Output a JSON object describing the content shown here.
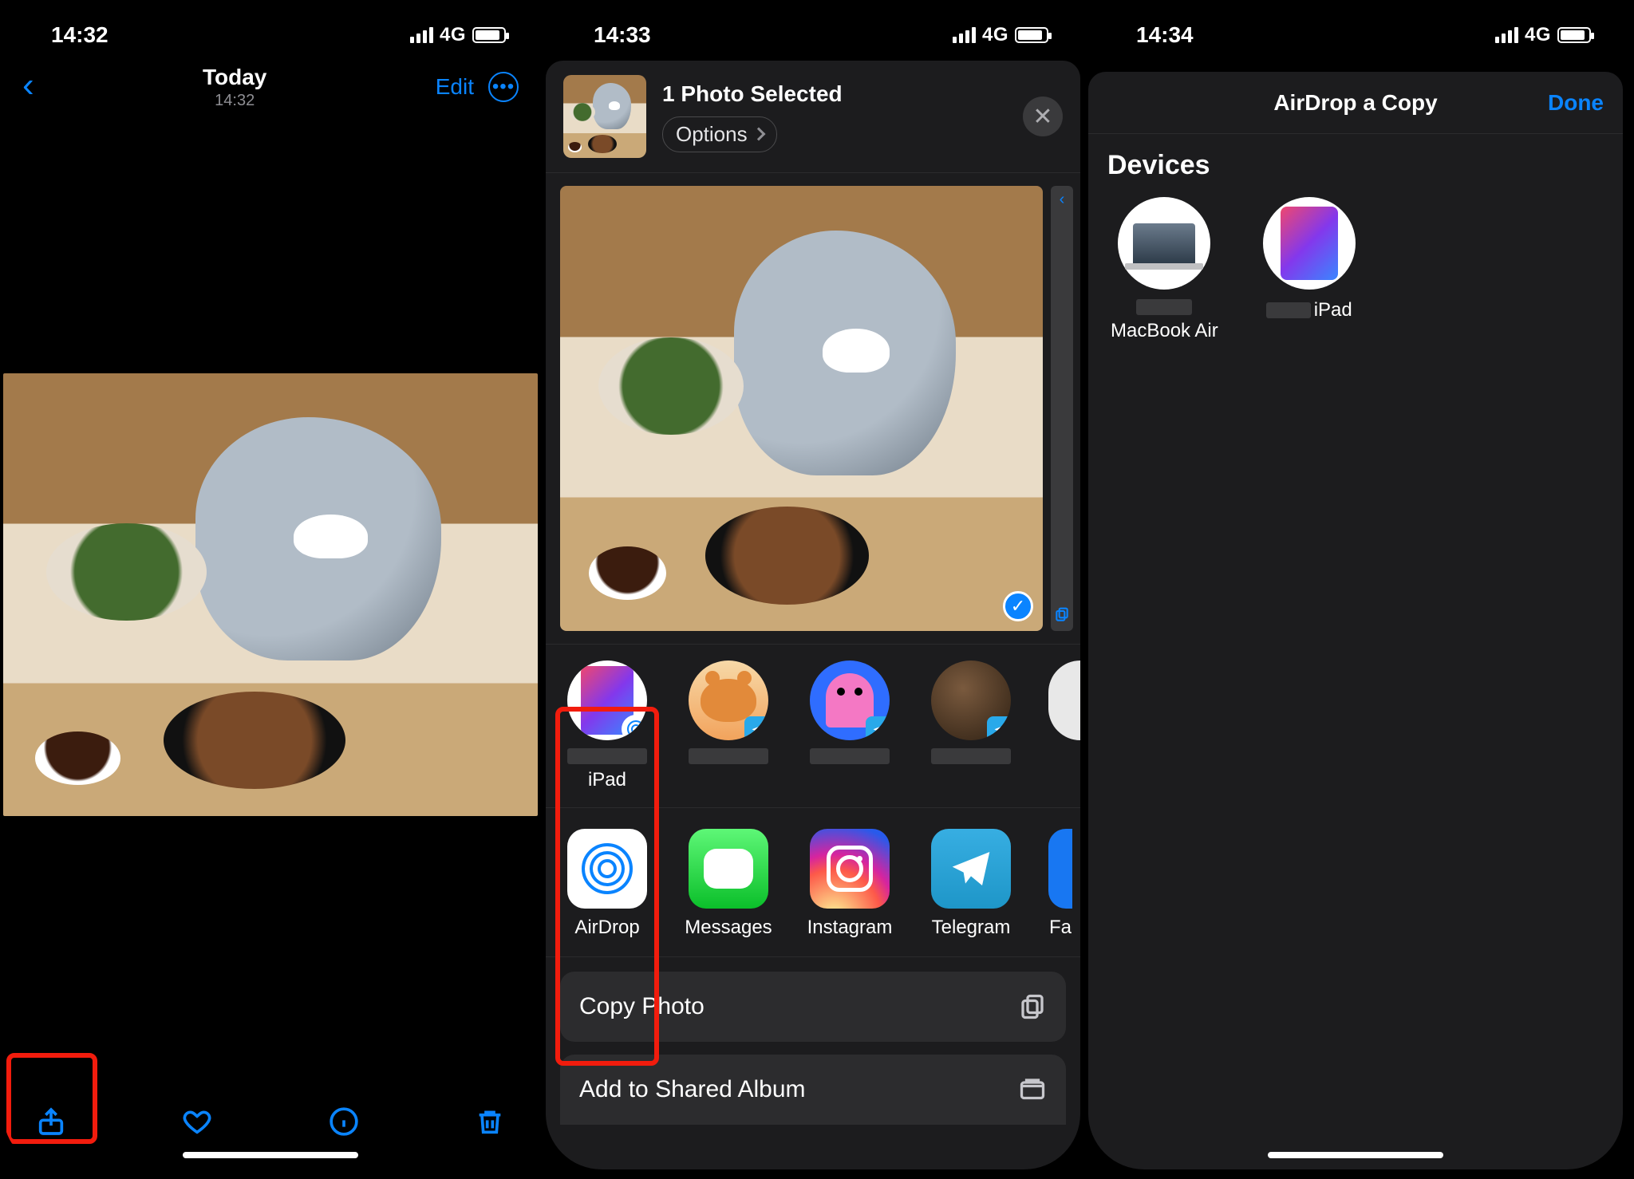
{
  "screen1": {
    "status": {
      "time": "14:32",
      "network": "4G"
    },
    "nav": {
      "title": "Today",
      "subtitle": "14:32",
      "edit": "Edit"
    }
  },
  "screen2": {
    "status": {
      "time": "14:33",
      "network": "4G"
    },
    "selected_title": "1 Photo Selected",
    "options": "Options",
    "contacts": [
      {
        "label": "iPad"
      },
      {
        "label": ""
      },
      {
        "label": ""
      },
      {
        "label": ""
      }
    ],
    "apps": {
      "airdrop": "AirDrop",
      "messages": "Messages",
      "instagram": "Instagram",
      "telegram": "Telegram",
      "facebook": "Fa"
    },
    "actions": {
      "copy": "Copy Photo",
      "shared_album": "Add to Shared Album"
    }
  },
  "screen3": {
    "status": {
      "time": "14:34",
      "network": "4G"
    },
    "title": "AirDrop a Copy",
    "done": "Done",
    "section": "Devices",
    "devices": {
      "mac": "MacBook Air",
      "ipad": "iPad"
    }
  }
}
